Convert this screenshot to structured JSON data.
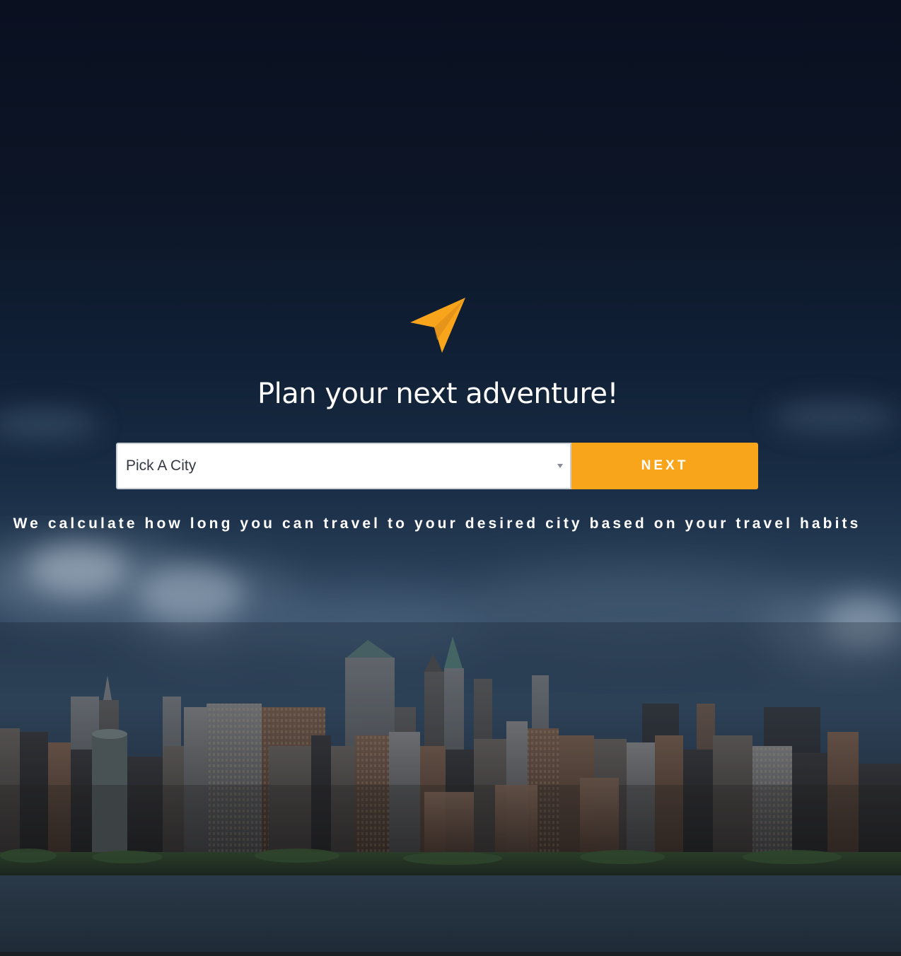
{
  "hero": {
    "title": "Plan your next adventure!",
    "tagline": "We calculate how long you can travel to your desired city based on your travel habits",
    "logo_icon": "paper-plane-icon"
  },
  "search": {
    "city_select": {
      "selected_value": "Pick A City"
    },
    "next_label": "NEXT"
  },
  "colors": {
    "accent": "#f9a51c",
    "text": "#ffffff",
    "sky_dark": "#0a1020"
  }
}
